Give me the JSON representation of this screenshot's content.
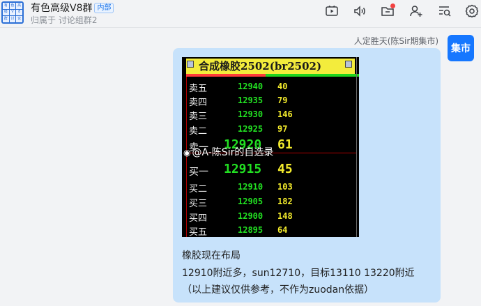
{
  "header": {
    "group_name": "有色高级V8群",
    "tag": "内部",
    "subtitle": "归属于 讨论组群2",
    "avatar_chars": [
      "有",
      "色",
      "高",
      "级",
      "V",
      "8",
      "群",
      "讨",
      "论"
    ]
  },
  "toolbar": {
    "icons": [
      "video-icon",
      "voice-icon",
      "folder-icon",
      "add-member-icon",
      "search-record-icon",
      "settings-icon"
    ]
  },
  "message": {
    "sender": "人定胜天(陈Sir期集市)",
    "avatar_text": "集市",
    "lines": [
      "橡胶现在布局",
      "12910附近多，sun12710，目标13110 13220附近",
      "（以上建议仅供参考，不作为zuodan依据）"
    ]
  },
  "quote_image": {
    "title": "合成橡胶2502(br2502)",
    "watermark": "@A-陈Sir的自选录",
    "asks": [
      {
        "label": "卖五",
        "price": "12940",
        "volume": "40"
      },
      {
        "label": "卖四",
        "price": "12935",
        "volume": "79"
      },
      {
        "label": "卖三",
        "price": "12930",
        "volume": "146"
      },
      {
        "label": "卖二",
        "price": "12925",
        "volume": "97"
      },
      {
        "label": "卖一",
        "price": "12920",
        "volume": "61"
      }
    ],
    "bids": [
      {
        "label": "买一",
        "price": "12915",
        "volume": "45"
      },
      {
        "label": "买二",
        "price": "12910",
        "volume": "103"
      },
      {
        "label": "买三",
        "price": "12905",
        "volume": "182"
      },
      {
        "label": "买四",
        "price": "12900",
        "volume": "148"
      },
      {
        "label": "买五",
        "price": "12895",
        "volume": "64"
      }
    ]
  },
  "colors": {
    "accent": "#1677ff",
    "bubble": "#c7e2fb",
    "price_green": "#22e022",
    "volume_yellow": "#f4ec2c",
    "notification_red": "#f24141"
  }
}
